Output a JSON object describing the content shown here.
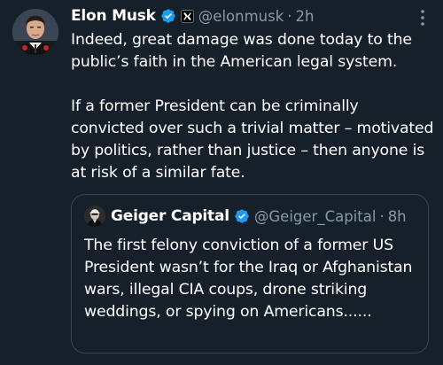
{
  "tweet": {
    "author_name": "Elon Musk",
    "handle": "@elonmusk",
    "separator": "·",
    "time": "2h",
    "text": "Indeed, great damage was done today to the public’s faith in the American legal system.\n\nIf a former President can be criminally convicted over such a trivial matter – motivated by politics, rather than justice – then anyone is at risk of a similar fate."
  },
  "quoted_tweet": {
    "author_name": "Geiger Capital",
    "handle": "@Geiger_Capital",
    "separator": "·",
    "time": "8h",
    "text": "The first felony conviction of a former US President wasn’t for the Iraq or Afghanistan wars, illegal CIA coups, drone striking weddings, or spying on Americans......"
  },
  "colors": {
    "background": "#15202b",
    "verified_badge": "#1d9bf0",
    "secondary_text": "#8b98a5",
    "border": "#38444d"
  },
  "icons": {
    "verified": "verified-badge-icon",
    "affiliation": "x-logo-icon",
    "more": "more-options-icon"
  }
}
